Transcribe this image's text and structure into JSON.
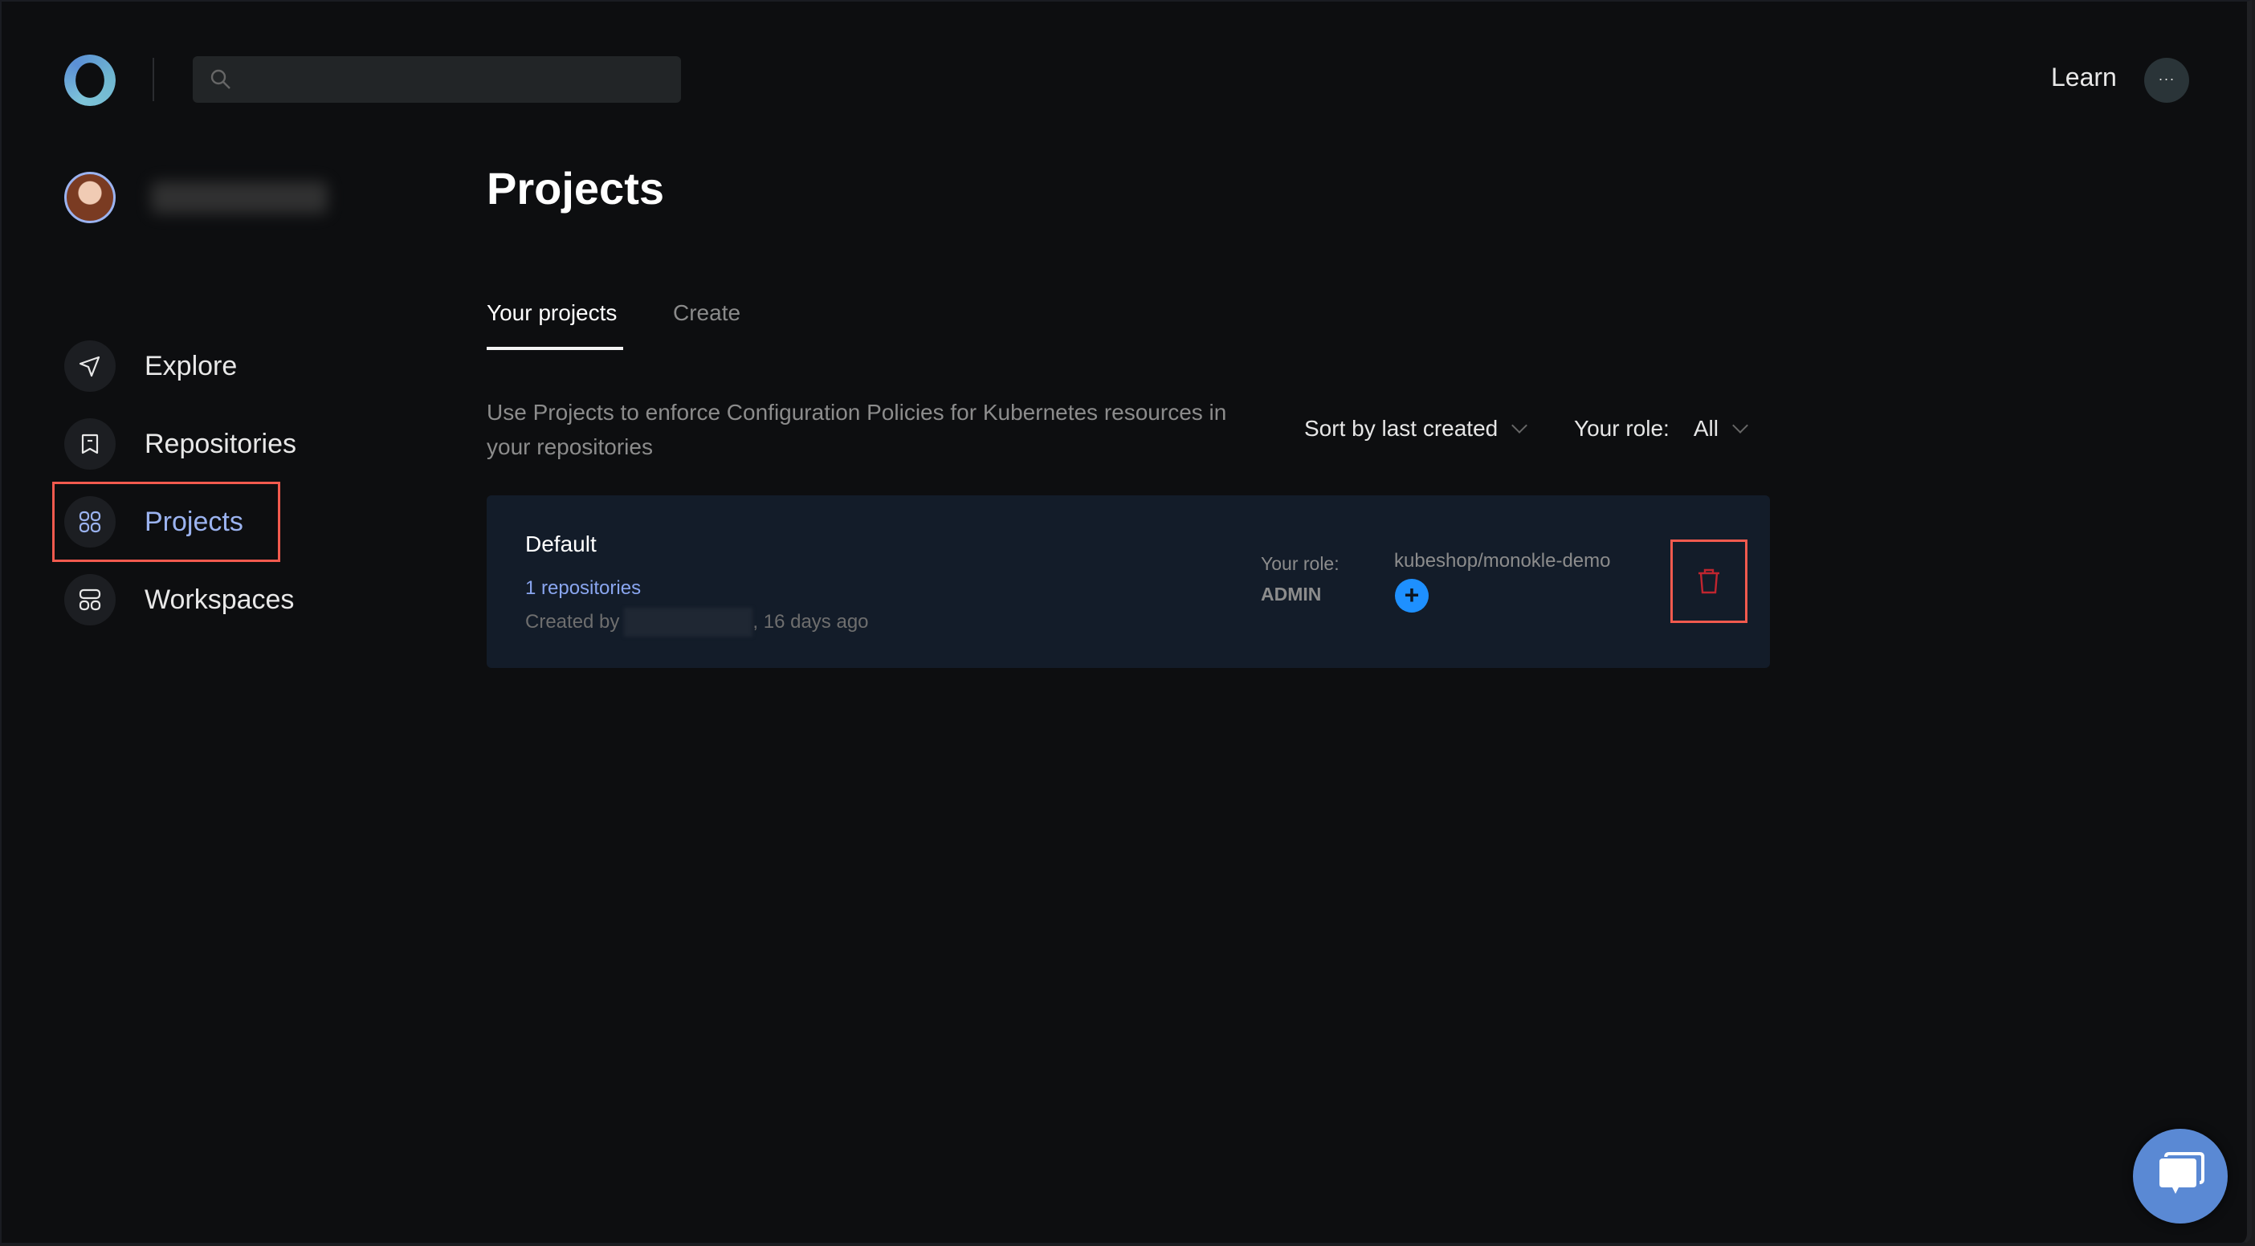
{
  "header": {
    "logo": "monokle-logo-ring",
    "search": {
      "placeholder": "",
      "value": "",
      "icon": "search-icon"
    },
    "learn_label": "Learn",
    "more_label": "···"
  },
  "sidebar": {
    "user": {
      "avatar": "user-avatar",
      "name": "[blurred username]"
    },
    "items": [
      {
        "label": "Explore",
        "icon": "paper-plane-icon",
        "active": false
      },
      {
        "label": "Repositories",
        "icon": "bookmark-icon",
        "active": false
      },
      {
        "label": "Projects",
        "icon": "grid-icon",
        "active": true
      },
      {
        "label": "Workspaces",
        "icon": "layout-icon",
        "active": false
      }
    ]
  },
  "main": {
    "title": "Projects",
    "tabs": [
      {
        "label": "Your projects",
        "active": true
      },
      {
        "label": "Create",
        "active": false
      }
    ],
    "description": "Use Projects to enforce Configuration Policies for Kubernetes resources in your repositories",
    "sort": {
      "label": "Sort by last created"
    },
    "role_filter": {
      "label": "Your role:",
      "value": "All"
    },
    "projects": [
      {
        "name": "Default",
        "repositories_link": "1 repositories",
        "created_prefix": "Created by",
        "created_suffix": ", 16 days ago",
        "role_label": "Your role:",
        "role_value": "ADMIN",
        "repo": "kubeshop/monokle-demo",
        "add_label": "+"
      }
    ]
  },
  "colors": {
    "accent": "#9bb3f0",
    "link": "#8aa6f0",
    "add_button": "#1e90ff",
    "delete": "#c0252f",
    "highlight": "#f25a4e",
    "chat": "#5a89d4",
    "card_bg": "#131c29"
  }
}
